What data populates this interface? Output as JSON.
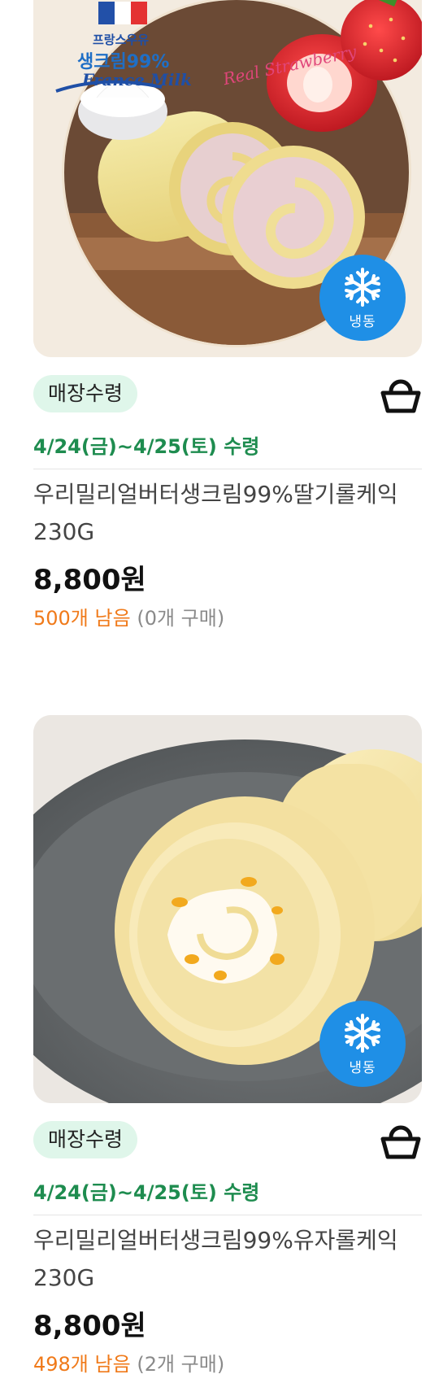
{
  "products": [
    {
      "image_text": {
        "flag_line": "프랑스우유",
        "cream_line": "생크림99%",
        "france_milk": "France Milk",
        "real_strawberry": "Real Strawberry"
      },
      "frozen_label": "냉동",
      "pickup_badge": "매장수령",
      "date_line": "4/24(금)~4/25(토) 수령",
      "title": "우리밀리얼버터생크림99%딸기롤케익230G",
      "price": "8,800원",
      "stock_remaining": "500개 남음",
      "purchased": "(0개 구매)"
    },
    {
      "frozen_label": "냉동",
      "pickup_badge": "매장수령",
      "date_line": "4/24(금)~4/25(토) 수령",
      "title": "우리밀리얼버터생크림99%유자롤케익230G",
      "price": "8,800원",
      "stock_remaining": "498개 남음",
      "purchased": "(2개 구매)"
    }
  ],
  "colors": {
    "pickup_badge_bg": "#dff6ea",
    "date_green": "#1e8c4f",
    "stock_orange": "#f07a1a",
    "frozen_blue": "#1f8fe6"
  },
  "icons": [
    "snowflake-icon",
    "shopping-basket-icon"
  ]
}
